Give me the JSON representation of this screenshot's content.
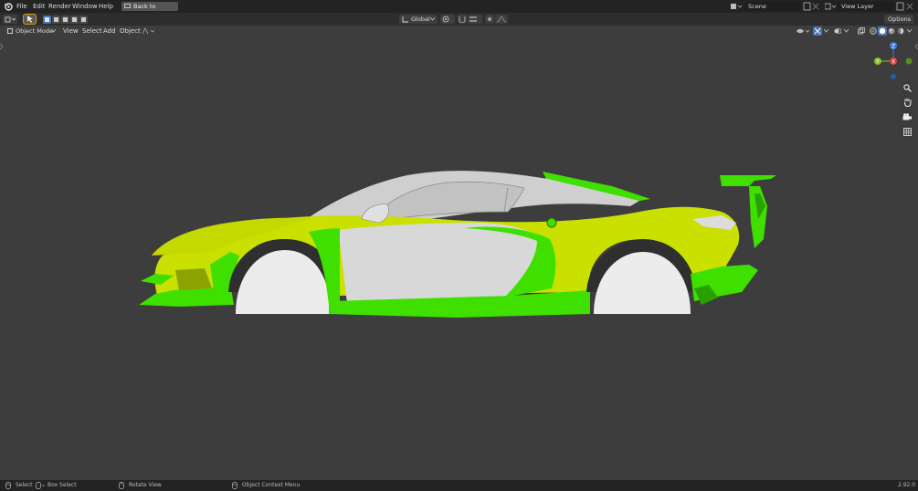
{
  "menu": {
    "file": "File",
    "edit": "Edit",
    "render": "Render",
    "window": "Window",
    "help": "Help",
    "back": "Back to Previous"
  },
  "scene": {
    "name": "Scene"
  },
  "view_layer": {
    "name": "View Layer"
  },
  "toolbar": {
    "transform_orientation": "Global",
    "options": "Options"
  },
  "header": {
    "mode": "Object Mode",
    "view": "View",
    "select": "Select",
    "add": "Add",
    "object": "Object"
  },
  "gizmo": {
    "z": "Z",
    "x": "X",
    "y": "Y",
    "colors": {
      "x": "#e0413d",
      "y": "#86c12b",
      "z": "#3b7de0"
    }
  },
  "status": {
    "select": "Select",
    "box_select": "Box Select",
    "rotate_view": "Rotate View",
    "context_menu": "Object Context Menu",
    "version": "2.92.0"
  },
  "colors": {
    "highlight_green": "#3fe000",
    "yellow_green": "#c9e000",
    "body_gray": "#d4d4d4",
    "viewport_bg": "#3d3d3d"
  }
}
